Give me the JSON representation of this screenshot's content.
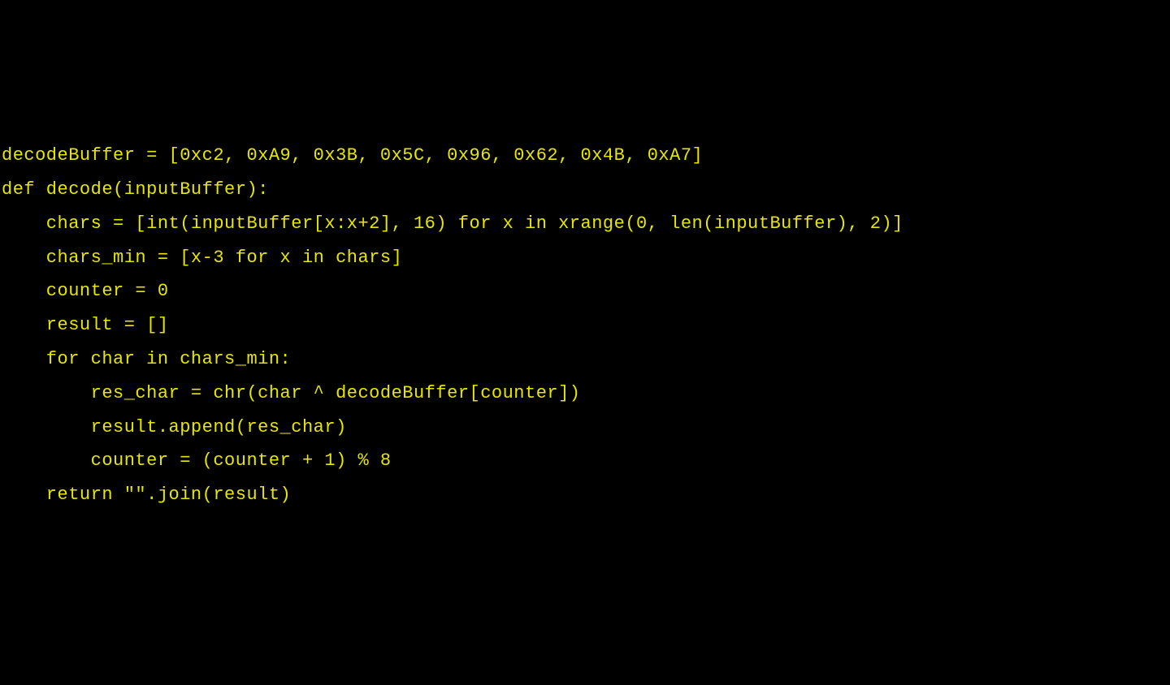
{
  "code": {
    "lines": [
      "decodeBuffer = [0xc2, 0xA9, 0x3B, 0x5C, 0x96, 0x62, 0x4B, 0xA7]",
      "",
      "def decode(inputBuffer):",
      "    chars = [int(inputBuffer[x:x+2], 16) for x in xrange(0, len(inputBuffer), 2)]",
      "    chars_min = [x-3 for x in chars]",
      "    counter = 0",
      "    result = []",
      "    for char in chars_min:",
      "        res_char = chr(char ^ decodeBuffer[counter])",
      "        result.append(res_char)",
      "        counter = (counter + 1) % 8",
      "    return \"\".join(result)"
    ]
  }
}
